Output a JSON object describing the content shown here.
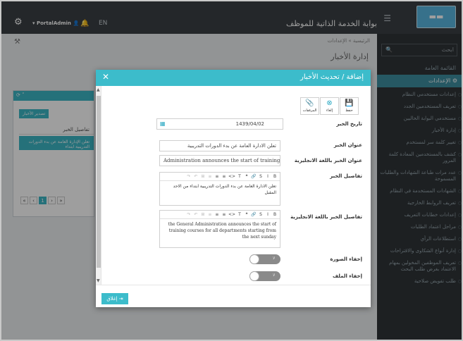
{
  "header": {
    "app_title": "بوابة الخدمة الذاتية للموظف",
    "language": "EN",
    "username": "PortalAdmin"
  },
  "sidebar": {
    "search_placeholder": "ابحث",
    "items": [
      {
        "label": "القائمة العامة"
      },
      {
        "label": "الإعدادات",
        "active": true
      }
    ],
    "settings_items": [
      "إعدادات مستخدمي النظام",
      "تعريف المستخدمين الجدد",
      "مستخدمي البوابة الحاليين",
      "إدارة الأخبار",
      "تغيير كلمة سر لمستخدم",
      "كشف بالمستخدمين المعادة كلمة المرور",
      "عدد مرات طباعة الشهادات والطلبات المسموحة",
      "الشهادات المستخدمة في النظام",
      "تعريف الروابط الخارجية",
      "إعدادات خطابات التعريف",
      "مراحل اعتماد الطلبات",
      "استطلاعات الرأي",
      "إدارة أنواع الشكاوى والاقتراحات",
      "تعريف الموظفين المخولين بمهام الاعتماد بغرض طلب البحث",
      "طلب تفويض صلاحية"
    ]
  },
  "main": {
    "breadcrumb_home": "الرئيسية",
    "breadcrumb_sep": "»",
    "breadcrumb_current": "الإعدادات",
    "page_title": "إدارة الأخبار",
    "panel": {
      "button": "تصدير الأخبار",
      "column_header": "تفاصيل الخبر",
      "row_text": "تعلن الإدارة العامة عن بدء الدورات التدريبية ابتداء",
      "pager": [
        "«",
        "‹",
        "1",
        "›",
        "»"
      ],
      "current_page": "1"
    }
  },
  "modal": {
    "title": "إضافة / تحديث الأخبار",
    "actions": {
      "save": "حفظ",
      "cancel": "إلغاء",
      "attachments": "المرفقات"
    },
    "fields": {
      "date_label": "تاريخ الخبر",
      "date_value": "1439/04/02",
      "title_label": "عنوان الخبر",
      "title_value": "تعلن الادارة العامة عن بدء الدورات التدريبية",
      "title_en_label": "عنوان الخبر باللغة الانجليزية",
      "title_en_value": "Administration announces the start of training courses",
      "details_label": "تفاصيل الخبر",
      "details_value": "تعلن الادارة العامة عن بدء الدورات التدريبية ابتداء من الاحد المقبل",
      "details_en_label": "تفاصيل الخبر باللغة الانجليزية",
      "details_en_value": "the General Administration announces the start of training courses for all departments starting from the next sunday",
      "hide_image_label": "إخفاء الصورة",
      "hide_file_label": "إخفاء الملف",
      "toggle_text": "لا"
    },
    "editor_toolbar": [
      "B",
      "I",
      "S",
      "🔗",
      "❝",
      "T",
      "<>",
      "≡",
      "≡",
      "≡",
      "⊞",
      "↶",
      "↷"
    ],
    "close_button": "إغلاق"
  },
  "colors": {
    "accent": "#3cbccb",
    "topbar": "#3a3f44",
    "sidebar": "#2f3438"
  }
}
